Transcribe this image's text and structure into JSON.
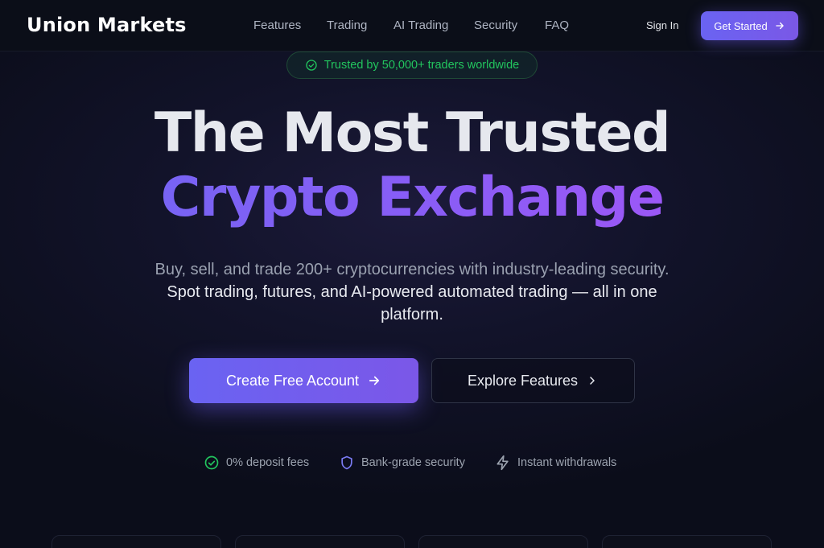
{
  "brand": {
    "name": "Union Markets"
  },
  "nav": {
    "links": [
      {
        "label": "Features"
      },
      {
        "label": "Trading"
      },
      {
        "label": "AI Trading"
      },
      {
        "label": "Security"
      },
      {
        "label": "FAQ"
      }
    ],
    "sign_in": "Sign In",
    "get_started": "Get Started"
  },
  "hero": {
    "badge": "Trusted by 50,000+ traders worldwide",
    "title_line1": "The Most Trusted",
    "title_line2": "Crypto Exchange",
    "subtitle_plain": "Buy, sell, and trade 200+ cryptocurrencies with industry-leading security.",
    "subtitle_highlight": "Spot trading, futures, and AI-powered automated trading — all in one platform.",
    "primary_cta": "Create Free Account",
    "secondary_cta": "Explore Features"
  },
  "features": [
    {
      "label": "0% deposit fees",
      "icon": "check-circle-icon"
    },
    {
      "label": "Bank-grade security",
      "icon": "shield-icon"
    },
    {
      "label": "Instant withdrawals",
      "icon": "lightning-icon"
    }
  ],
  "colors": {
    "accent": "#6a63f2",
    "accent_purple": "#8b5cf6",
    "success": "#22c55e",
    "background": "#0b0d1a"
  }
}
